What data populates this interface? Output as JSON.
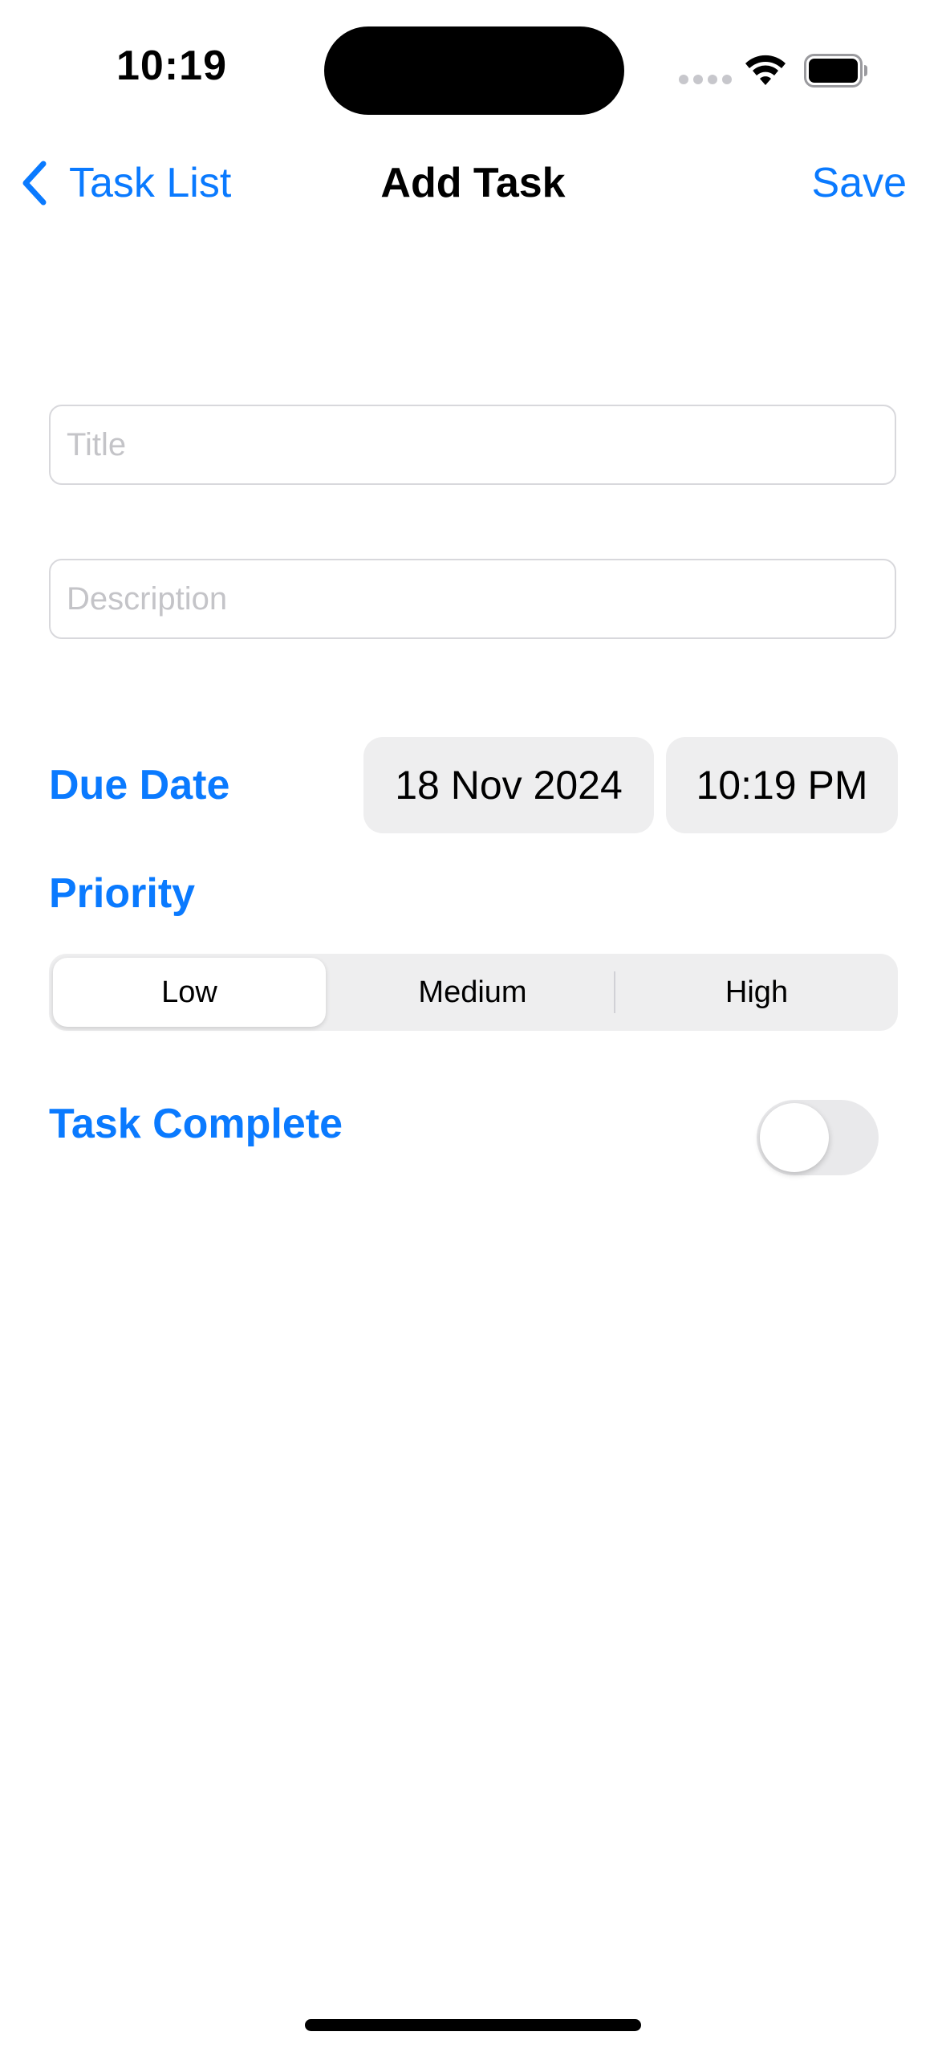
{
  "status_bar": {
    "time": "10:19",
    "icons": [
      "signal-icon",
      "wifi-icon",
      "battery-icon"
    ]
  },
  "nav": {
    "back_label": "Task List",
    "title": "Add Task",
    "save_label": "Save"
  },
  "form": {
    "title_placeholder": "Title",
    "title_value": "",
    "description_placeholder": "Description",
    "description_value": "",
    "due_date_label": "Due Date",
    "due_date_value": "18 Nov 2024",
    "due_time_value": "10:19 PM",
    "priority_label": "Priority",
    "priority_options": [
      "Low",
      "Medium",
      "High"
    ],
    "priority_selected": "Low",
    "complete_label": "Task Complete",
    "complete_value": false
  },
  "colors": {
    "accent": "#0a7aff",
    "control_bg": "#eeeeef"
  }
}
